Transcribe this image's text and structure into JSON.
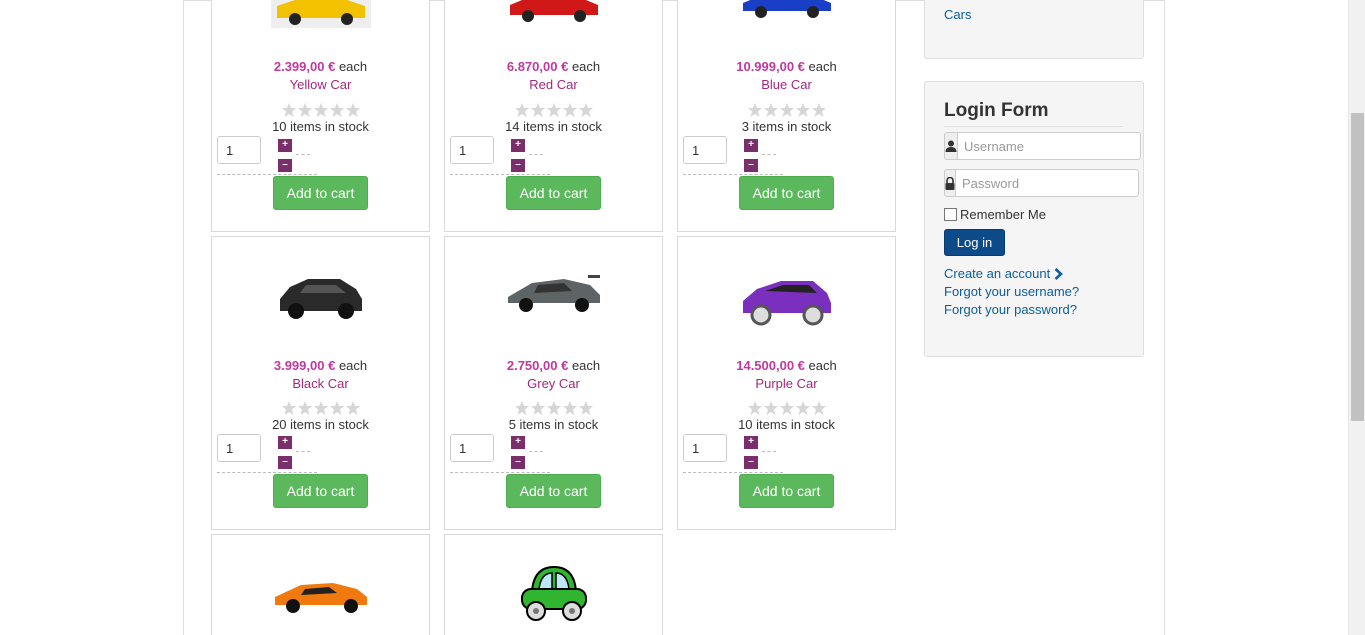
{
  "products": [
    {
      "price": "2.399,00 €",
      "each": "each",
      "name": "Yellow Car",
      "stock": "10 items in stock",
      "qty": "1",
      "add": "Add to cart",
      "color": "#f2c200"
    },
    {
      "price": "6.870,00 €",
      "each": "each",
      "name": "Red Car",
      "stock": "14 items in stock",
      "qty": "1",
      "add": "Add to cart",
      "color": "#d01818"
    },
    {
      "price": "10.999,00 €",
      "each": "each",
      "name": "Blue Car",
      "stock": "3 items in stock",
      "qty": "1",
      "add": "Add to cart",
      "color": "#1a3fc7"
    },
    {
      "price": "3.999,00 €",
      "each": "each",
      "name": "Black Car",
      "stock": "20 items in stock",
      "qty": "1",
      "add": "Add to cart",
      "color": "#2a2a2a"
    },
    {
      "price": "2.750,00 €",
      "each": "each",
      "name": "Grey Car",
      "stock": "5 items in stock",
      "qty": "1",
      "add": "Add to cart",
      "color": "#5e6366"
    },
    {
      "price": "14.500,00 €",
      "each": "each",
      "name": "Purple Car",
      "stock": "10 items in stock",
      "qty": "1",
      "add": "Add to cart",
      "color": "#7b2fbf"
    },
    {
      "color": "#f07a10"
    },
    {
      "color": "#2fb52f"
    }
  ],
  "qty_plus": "+",
  "qty_minus": "–",
  "sidebar": {
    "categories_link": "Cars",
    "login": {
      "title": "Login Form",
      "username_placeholder": "Username",
      "password_placeholder": "Password",
      "remember": "Remember Me",
      "button": "Log in",
      "create_account": "Create an account",
      "forgot_username": "Forgot your username?",
      "forgot_password": "Forgot your password?"
    }
  }
}
